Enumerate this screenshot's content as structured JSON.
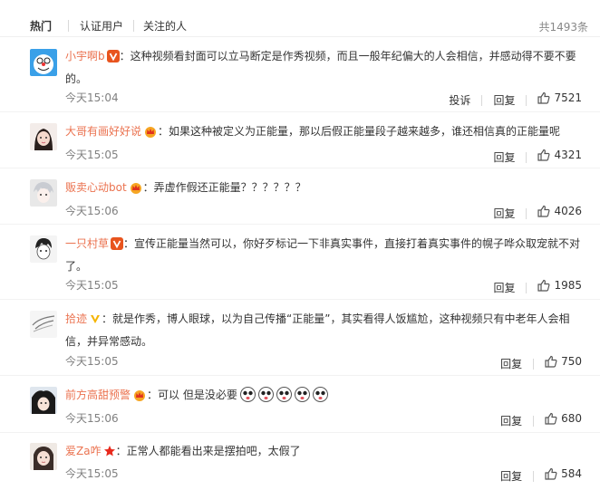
{
  "tabs": [
    {
      "label": "热门"
    },
    {
      "label": "认证用户"
    },
    {
      "label": "关注的人"
    }
  ],
  "total": "共1493条",
  "comments": [
    {
      "username": "小宇啊b",
      "badge": "v-orange",
      "text": "：这种视频看封面可以立马断定是作秀视频，而且一般年纪偏大的人会相信，并感动得不要不要的。",
      "time": "今天15:04",
      "report": "投诉",
      "reply": "回复",
      "likes": "7521"
    },
    {
      "username": "大哥有画好好说",
      "badge": "crown",
      "text": "：如果这种被定义为正能量，那以后假正能量段子越来越多，谁还相信真的正能量呢",
      "time": "今天15:05",
      "reply": "回复",
      "likes": "4321"
    },
    {
      "username": "贩卖心动bot",
      "badge": "crown",
      "text": "：弄虚作假还正能量？？？？？？",
      "time": "今天15:06",
      "reply": "回复",
      "likes": "4026"
    },
    {
      "username": "一只村草",
      "badge": "v-orange",
      "text": "：宣传正能量当然可以，你好歹标记一下非真实事件，直接打着真实事件的幌子哗众取宠就不对了。",
      "time": "今天15:05",
      "reply": "回复",
      "likes": "1985"
    },
    {
      "username": "拾迹",
      "badge": "v-yellow",
      "text": "：就是作秀，博人眼球，以为自己传播“正能量”，其实看得人饭尴尬，这种视频只有中老年人会相信，并异常感动。",
      "time": "今天15:05",
      "reply": "回复",
      "likes": "750"
    },
    {
      "username": "前方高甜预警",
      "badge": "crown",
      "text": "：可以 但是没必要",
      "emoji_count": 5,
      "time": "今天15:06",
      "reply": "回复",
      "likes": "680"
    },
    {
      "username": "爱Za咋",
      "badge": "star",
      "text": "：正常人都能看出来是摆拍吧，太假了",
      "time": "今天15:05",
      "reply": "回复",
      "likes": "584"
    }
  ],
  "colors": {
    "username": "#eb7350",
    "time": "#808080",
    "text": "#333333"
  }
}
